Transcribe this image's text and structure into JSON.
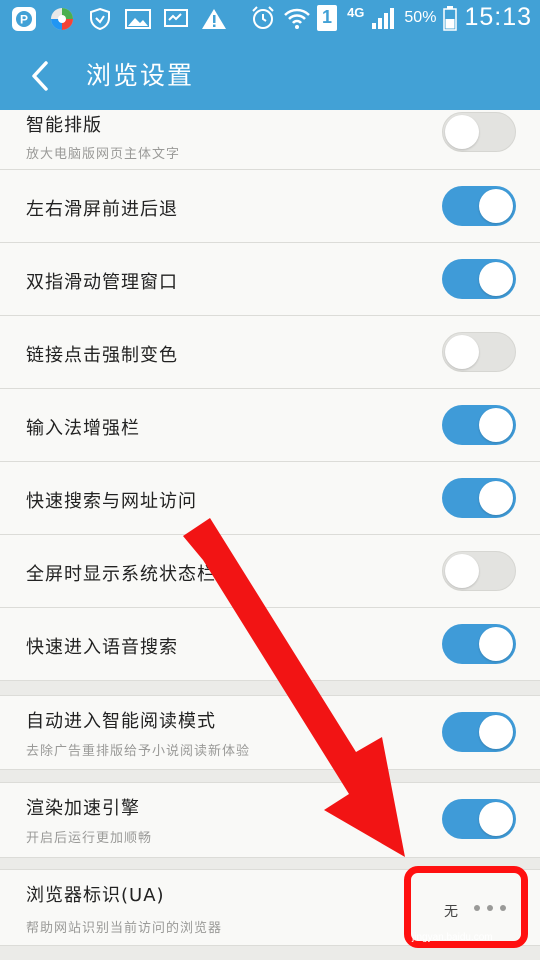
{
  "status_bar": {
    "network_type": "4G",
    "sim_badge": "1",
    "battery_percent": "50%",
    "time": "15:13"
  },
  "header": {
    "title": "浏览设置"
  },
  "settings": [
    {
      "title": "智能排版",
      "subtitle": "放大电脑版网页主体文字",
      "on": false
    },
    {
      "title": "左右滑屏前进后退",
      "on": true
    },
    {
      "title": "双指滑动管理窗口",
      "on": true
    },
    {
      "title": "链接点击强制变色",
      "on": false
    },
    {
      "title": "输入法增强栏",
      "on": true
    },
    {
      "title": "快速搜索与网址访问",
      "on": true
    },
    {
      "title": "全屏时显示系统状态栏",
      "on": false
    },
    {
      "title": "快速进入语音搜索",
      "on": true
    },
    {
      "title": "自动进入智能阅读模式",
      "subtitle": "去除广告重排版给予小说阅读新体验",
      "on": true
    },
    {
      "title": "渲染加速引擎",
      "subtitle": "开启后运行更加顺畅",
      "on": true
    }
  ],
  "ua_setting": {
    "title": "浏览器标识(UA)",
    "subtitle": "帮助网站识别当前访问的浏览器",
    "value": "无"
  },
  "colors": {
    "accent": "#42a1d6",
    "toggle_on": "#3f9bd8",
    "toggle_off": "#e3e3e0",
    "annotation": "#ff1010"
  },
  "watermark": "jingyan.baidu.com"
}
